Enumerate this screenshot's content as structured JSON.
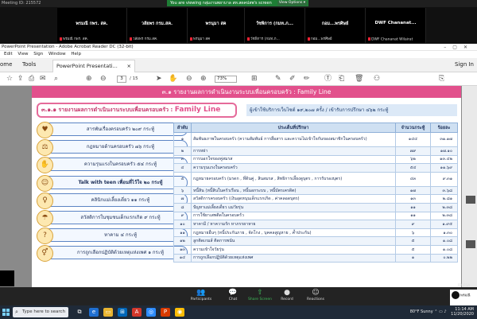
{
  "zoom": {
    "meeting_id": "Meeting ID: 215572",
    "banner_text": "You are viewing กลุ่มงานพยาบาล สท.สดคปสพ's screen",
    "view_options": "View Options ▾",
    "participants": [
      {
        "name": "พรมณี กพร. สค.",
        "small": "พรมณี กพร. สค."
      },
      {
        "name": "วลัยพร กรม.สค.",
        "small": "วลัยพร กรม.สค."
      },
      {
        "name": "พรนุมา สค",
        "small": "พรนุมา สค"
      },
      {
        "name": "วัชพิการ (กมท.ภ...",
        "small": "วัชพิการ (กมท.ภ..."
      },
      {
        "name": "กอม...พรศิษย์",
        "small": "กอม...พรศิษย์"
      },
      {
        "name": "DWF Chananat...",
        "small": "DWF Chananat Wilairat"
      }
    ],
    "controls": {
      "participants": "Participants",
      "participants_count": "7",
      "chat": "Chat",
      "share": "Share Screen",
      "record": "Record",
      "reactions": "Reactions"
    },
    "self_label": "FR_R1A",
    "self_tile_text": "พรมณี"
  },
  "acrobat": {
    "window_title": "PowerPoint Presentation - Adobe Acrobat Reader DC (32-bit)",
    "menu": [
      "Edit",
      "View",
      "Sign",
      "Window",
      "Help"
    ],
    "tabs": {
      "home": "ome",
      "tools": "Tools",
      "document": "PowerPoint Presentati...",
      "sign_in": "Sign In"
    },
    "page_current": "3",
    "page_total": "/ 15",
    "zoom_level": "73%"
  },
  "slide": {
    "header": "๓.๑ รายงานผลการดำเนินงานระบบเพื่อนครอบครัว : Family Line",
    "subtitle": "๓.๑.๑ รายงานผลการดำเนินงานระบบเพื่อนครอบครัว : ",
    "subtitle_brand": "Family Line",
    "note": "ผู้เข้าใช้บริการเว็บไซต์  ๑๙,๒๐๗ ครั้ง / เข้ารับการปรึกษา ๔๖๒ กระทู้",
    "topics": [
      {
        "label": "สารพันเรื่องครอบครัว ๒๐๙ กระทู้",
        "icon": "family-icon",
        "glyph": "♥"
      },
      {
        "label": "กฎหมายด้านครอบครัว ๗๖ กระทู้",
        "icon": "law-icon",
        "glyph": "⚖"
      },
      {
        "label": "ความรุนแรงในครอบครัว ๕๔ กระทู้",
        "icon": "violence-icon",
        "glyph": "✋"
      },
      {
        "label": "Talk with teen เพื่อนที่ไว้ใจ ๒๐ กระทู้",
        "icon": "teen-icon",
        "glyph": "☺"
      },
      {
        "label": "คลินิกแม่เลี้ยงเดี่ยว ๑๑ กระทู้",
        "icon": "single-mom-icon",
        "glyph": "♀"
      },
      {
        "label": "สวัสดิการในชุมชนเด็กแรกเกิด ๙ กระทู้",
        "icon": "welfare-icon",
        "glyph": "☂"
      },
      {
        "label": "หาคาม ๔ กระทู้",
        "icon": "search-people-icon",
        "glyph": "?"
      },
      {
        "label": "การถูกเลือกปฏิบัติด้วยเหตุแห่งเพศ ๑ กระทู้",
        "icon": "gender-icon",
        "glyph": "⚥"
      }
    ],
    "table": {
      "headers": [
        "ลำดับ",
        "ประเด็นที่ปรึกษา",
        "จำนวนกระทู้",
        "ร้อยละ"
      ],
      "rows": [
        [
          "๑",
          "สัมพันธภาพในครอบครัว (ความสัมพันธ์ การสื่อสาร และความไม่เข้าใจกันของสมาชิกในครอบครัว)",
          "๑๔๔",
          "๓๑.๑๗"
        ],
        [
          "๒",
          "การหย่า",
          "๗๙",
          "๑๗.๑๐"
        ],
        [
          "๓",
          "การนอกใจของคู่สมรส",
          "๖๒",
          "๑๓.๔๒"
        ],
        [
          "๔",
          "ความรุนแรงในครอบครัว",
          "๕๔",
          "๑๑.๖๙"
        ],
        [
          "๕",
          "กฎหมายครอบครัว (มรดก , ที่ดินคู่ , สินสมรส , สิทธิการเลี้ยงดูบุตร , การรับรองบุตร)",
          "๔๓",
          "๙.๓๑"
        ],
        [
          "๖",
          "หนี้สิน (หนี้สินในครัวเรือน , หนี้นอกระบบ , หนี้บัตรเครดิต)",
          "๑๗",
          "๓.๖๘"
        ],
        [
          "๗",
          "สวัสดิการครอบครัว (เงินอุดหนุนเด็กแรกเกิด , ค่าคลอดบุตร)",
          "๑๓",
          "๒.๘๑"
        ],
        [
          "๘",
          "ปัญหาแม่เลี้ยงเดี่ยว แม่วัยรุ่น",
          "๑๑",
          "๒.๓๘"
        ],
        [
          "๙",
          "การใช้ยาเสพติดในครอบครัว",
          "๑๑",
          "๒.๓๘"
        ],
        [
          "๑๐",
          "หาคามี / หาความรัก หาภรรยาหาย ",
          "๙",
          "๑.๙๕"
        ],
        [
          "๑๑",
          "กฎหมายอื่นๆ (หนี้ประกันภาย , จัดโกง , บุคคลสูญหาย , ค้ำประกัน)",
          "๖",
          "๑.๓๐"
        ],
        [
          "๑๒",
          "ลูกติดเกมส์ ติดการพนัน",
          "๕",
          "๑.๐๘"
        ],
        [
          "๑๓",
          "ความเข้าใจวัยรุ่น",
          "๕",
          "๑.๐๘"
        ],
        [
          "๑๔",
          "การถูกเลือกปฏิบัติด้วยเหตุแห่งเพศ",
          "๑",
          "๐.๒๒"
        ]
      ]
    }
  },
  "taskbar": {
    "search_placeholder": "Type here to search",
    "weather": "80°F  Sunny",
    "time": "11:14 AM",
    "date": "11/20/2020"
  },
  "colors": {
    "header_pink": "#e2508c",
    "zoom_green": "#1e7d35",
    "table_header": "#cfe0f2"
  }
}
